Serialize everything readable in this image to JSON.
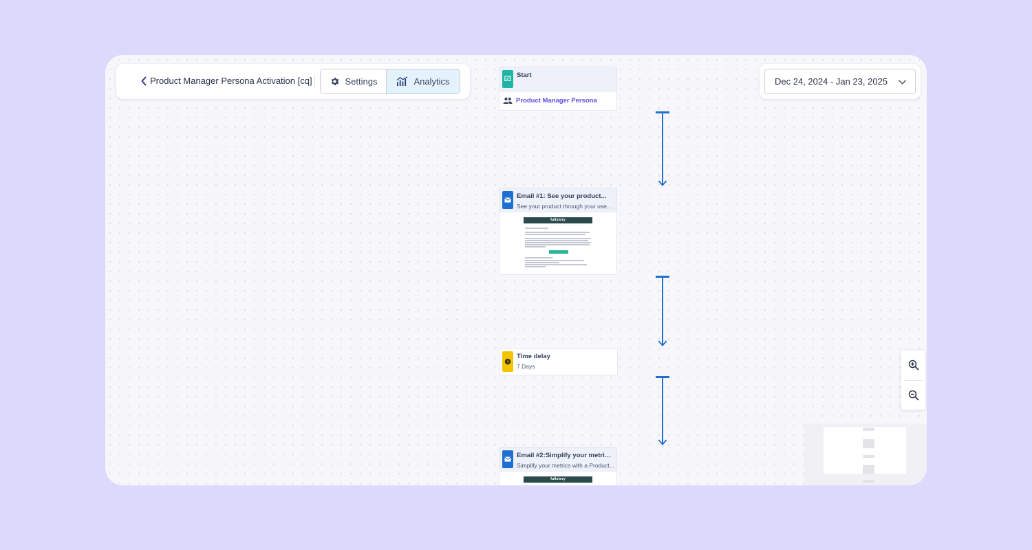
{
  "header": {
    "journey_title": "Product Manager Persona Activation [cq]",
    "settings_label": "Settings",
    "analytics_label": "Analytics"
  },
  "date_range": {
    "value": "Dec 24, 2024 - Jan 23, 2025"
  },
  "nodes": {
    "start": {
      "title": "Start",
      "audience": "Product Manager Persona"
    },
    "email1": {
      "title": "Email #1: See your product...",
      "subtitle": "See your product through your users'...",
      "brand": "fullstory"
    },
    "delay": {
      "title": "Time delay",
      "subtitle": "7 Days"
    },
    "email2": {
      "title": "Email #2:Simplify your metrics...",
      "subtitle": "Simplify your metrics with a Product...",
      "brand": "fullstory"
    }
  },
  "colors": {
    "start_icon": "#1fb5a4",
    "email_icon": "#1f6fd1",
    "delay_icon": "#f5c400",
    "connector": "#1f6fd1",
    "audience_text": "#5b4ee0",
    "background": "#dcd9fc"
  },
  "icons": {
    "back": "chevron-left-icon",
    "settings": "gear-icon",
    "analytics": "chart-icon",
    "date": "chevron-down-icon",
    "zoom_in": "zoom-in-icon",
    "zoom_out": "zoom-out-icon"
  }
}
